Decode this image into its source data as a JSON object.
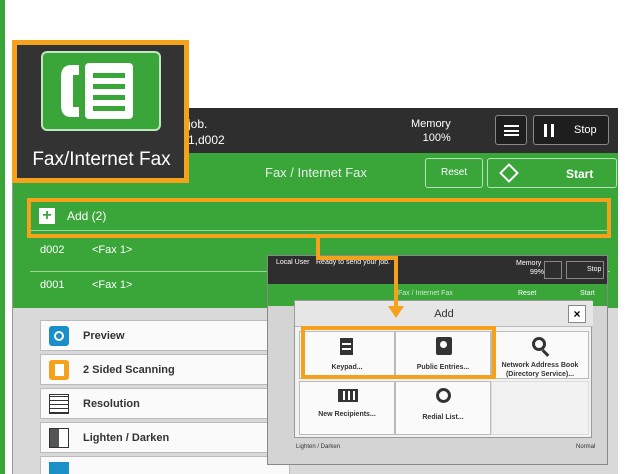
{
  "app": {
    "name": "Fax/Internet Fax"
  },
  "status": {
    "line1": "job.",
    "line2": "1,d002",
    "memory_label": "Memory",
    "memory_value": "100%",
    "stop": "Stop"
  },
  "header": {
    "title": "Fax / Internet Fax",
    "reset": "Reset",
    "start": "Start"
  },
  "recipients": {
    "add_label": "Add (2)",
    "rows": [
      {
        "id": "d002",
        "name": "<Fax 1>"
      },
      {
        "id": "d001",
        "name": "<Fax 1>"
      }
    ]
  },
  "features": [
    {
      "label": "Preview",
      "icon": "eye-icon"
    },
    {
      "label": "2 Sided Scanning",
      "icon": "two-sided-icon"
    },
    {
      "label": "Resolution",
      "icon": "resolution-grid-icon"
    },
    {
      "label": "Lighten / Darken",
      "icon": "contrast-icon"
    }
  ],
  "sub_screen": {
    "user": "Local User",
    "message": "Ready to send your job.",
    "memory_label": "Memory",
    "memory_value": "99%",
    "stop": "Stop",
    "header_title": "Fax / Internet Fax",
    "reset": "Reset",
    "start": "Start",
    "lighten": "Lighten / Darken",
    "normal": "Normal"
  },
  "dialog": {
    "title": "Add",
    "close": "×",
    "items": [
      {
        "label": "Keypad...",
        "icon": "keypad-icon"
      },
      {
        "label": "Public Entries...",
        "icon": "address-book-icon"
      },
      {
        "label": "Network Address Book (Directory Service)...",
        "icon": "search-icon"
      },
      {
        "label": "New Recipients...",
        "icon": "keyboard-icon"
      },
      {
        "label": "Redial List...",
        "icon": "redial-history-icon"
      }
    ]
  },
  "colors": {
    "accent_green": "#3aa63a",
    "highlight_orange": "#f4a11c",
    "dark_bar": "#2e2e2e"
  }
}
